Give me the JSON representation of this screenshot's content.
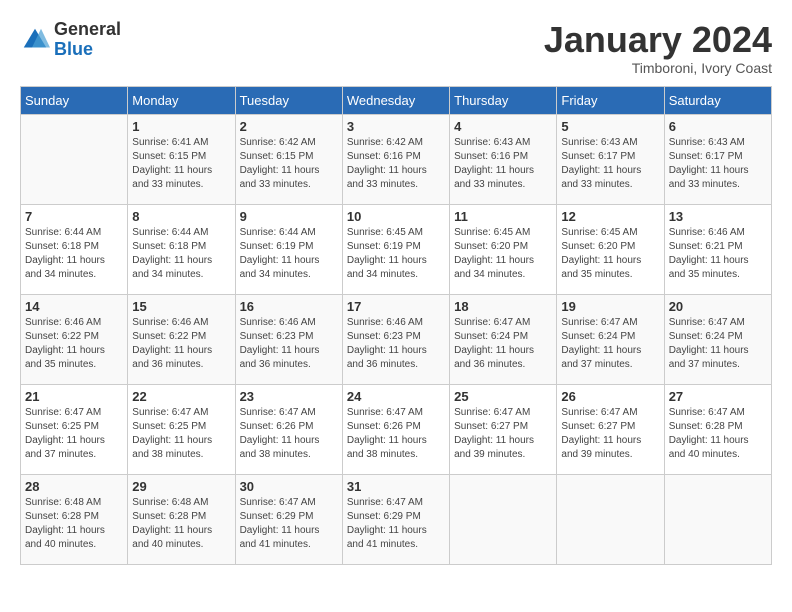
{
  "header": {
    "logo_general": "General",
    "logo_blue": "Blue",
    "month_title": "January 2024",
    "subtitle": "Timboroni, Ivory Coast"
  },
  "days_of_week": [
    "Sunday",
    "Monday",
    "Tuesday",
    "Wednesday",
    "Thursday",
    "Friday",
    "Saturday"
  ],
  "weeks": [
    [
      {
        "day": "",
        "sunrise": "",
        "sunset": "",
        "daylight": ""
      },
      {
        "day": "1",
        "sunrise": "Sunrise: 6:41 AM",
        "sunset": "Sunset: 6:15 PM",
        "daylight": "Daylight: 11 hours and 33 minutes."
      },
      {
        "day": "2",
        "sunrise": "Sunrise: 6:42 AM",
        "sunset": "Sunset: 6:15 PM",
        "daylight": "Daylight: 11 hours and 33 minutes."
      },
      {
        "day": "3",
        "sunrise": "Sunrise: 6:42 AM",
        "sunset": "Sunset: 6:16 PM",
        "daylight": "Daylight: 11 hours and 33 minutes."
      },
      {
        "day": "4",
        "sunrise": "Sunrise: 6:43 AM",
        "sunset": "Sunset: 6:16 PM",
        "daylight": "Daylight: 11 hours and 33 minutes."
      },
      {
        "day": "5",
        "sunrise": "Sunrise: 6:43 AM",
        "sunset": "Sunset: 6:17 PM",
        "daylight": "Daylight: 11 hours and 33 minutes."
      },
      {
        "day": "6",
        "sunrise": "Sunrise: 6:43 AM",
        "sunset": "Sunset: 6:17 PM",
        "daylight": "Daylight: 11 hours and 33 minutes."
      }
    ],
    [
      {
        "day": "7",
        "sunrise": "Sunrise: 6:44 AM",
        "sunset": "Sunset: 6:18 PM",
        "daylight": "Daylight: 11 hours and 34 minutes."
      },
      {
        "day": "8",
        "sunrise": "Sunrise: 6:44 AM",
        "sunset": "Sunset: 6:18 PM",
        "daylight": "Daylight: 11 hours and 34 minutes."
      },
      {
        "day": "9",
        "sunrise": "Sunrise: 6:44 AM",
        "sunset": "Sunset: 6:19 PM",
        "daylight": "Daylight: 11 hours and 34 minutes."
      },
      {
        "day": "10",
        "sunrise": "Sunrise: 6:45 AM",
        "sunset": "Sunset: 6:19 PM",
        "daylight": "Daylight: 11 hours and 34 minutes."
      },
      {
        "day": "11",
        "sunrise": "Sunrise: 6:45 AM",
        "sunset": "Sunset: 6:20 PM",
        "daylight": "Daylight: 11 hours and 34 minutes."
      },
      {
        "day": "12",
        "sunrise": "Sunrise: 6:45 AM",
        "sunset": "Sunset: 6:20 PM",
        "daylight": "Daylight: 11 hours and 35 minutes."
      },
      {
        "day": "13",
        "sunrise": "Sunrise: 6:46 AM",
        "sunset": "Sunset: 6:21 PM",
        "daylight": "Daylight: 11 hours and 35 minutes."
      }
    ],
    [
      {
        "day": "14",
        "sunrise": "Sunrise: 6:46 AM",
        "sunset": "Sunset: 6:22 PM",
        "daylight": "Daylight: 11 hours and 35 minutes."
      },
      {
        "day": "15",
        "sunrise": "Sunrise: 6:46 AM",
        "sunset": "Sunset: 6:22 PM",
        "daylight": "Daylight: 11 hours and 36 minutes."
      },
      {
        "day": "16",
        "sunrise": "Sunrise: 6:46 AM",
        "sunset": "Sunset: 6:23 PM",
        "daylight": "Daylight: 11 hours and 36 minutes."
      },
      {
        "day": "17",
        "sunrise": "Sunrise: 6:46 AM",
        "sunset": "Sunset: 6:23 PM",
        "daylight": "Daylight: 11 hours and 36 minutes."
      },
      {
        "day": "18",
        "sunrise": "Sunrise: 6:47 AM",
        "sunset": "Sunset: 6:24 PM",
        "daylight": "Daylight: 11 hours and 36 minutes."
      },
      {
        "day": "19",
        "sunrise": "Sunrise: 6:47 AM",
        "sunset": "Sunset: 6:24 PM",
        "daylight": "Daylight: 11 hours and 37 minutes."
      },
      {
        "day": "20",
        "sunrise": "Sunrise: 6:47 AM",
        "sunset": "Sunset: 6:24 PM",
        "daylight": "Daylight: 11 hours and 37 minutes."
      }
    ],
    [
      {
        "day": "21",
        "sunrise": "Sunrise: 6:47 AM",
        "sunset": "Sunset: 6:25 PM",
        "daylight": "Daylight: 11 hours and 37 minutes."
      },
      {
        "day": "22",
        "sunrise": "Sunrise: 6:47 AM",
        "sunset": "Sunset: 6:25 PM",
        "daylight": "Daylight: 11 hours and 38 minutes."
      },
      {
        "day": "23",
        "sunrise": "Sunrise: 6:47 AM",
        "sunset": "Sunset: 6:26 PM",
        "daylight": "Daylight: 11 hours and 38 minutes."
      },
      {
        "day": "24",
        "sunrise": "Sunrise: 6:47 AM",
        "sunset": "Sunset: 6:26 PM",
        "daylight": "Daylight: 11 hours and 38 minutes."
      },
      {
        "day": "25",
        "sunrise": "Sunrise: 6:47 AM",
        "sunset": "Sunset: 6:27 PM",
        "daylight": "Daylight: 11 hours and 39 minutes."
      },
      {
        "day": "26",
        "sunrise": "Sunrise: 6:47 AM",
        "sunset": "Sunset: 6:27 PM",
        "daylight": "Daylight: 11 hours and 39 minutes."
      },
      {
        "day": "27",
        "sunrise": "Sunrise: 6:47 AM",
        "sunset": "Sunset: 6:28 PM",
        "daylight": "Daylight: 11 hours and 40 minutes."
      }
    ],
    [
      {
        "day": "28",
        "sunrise": "Sunrise: 6:48 AM",
        "sunset": "Sunset: 6:28 PM",
        "daylight": "Daylight: 11 hours and 40 minutes."
      },
      {
        "day": "29",
        "sunrise": "Sunrise: 6:48 AM",
        "sunset": "Sunset: 6:28 PM",
        "daylight": "Daylight: 11 hours and 40 minutes."
      },
      {
        "day": "30",
        "sunrise": "Sunrise: 6:47 AM",
        "sunset": "Sunset: 6:29 PM",
        "daylight": "Daylight: 11 hours and 41 minutes."
      },
      {
        "day": "31",
        "sunrise": "Sunrise: 6:47 AM",
        "sunset": "Sunset: 6:29 PM",
        "daylight": "Daylight: 11 hours and 41 minutes."
      },
      {
        "day": "",
        "sunrise": "",
        "sunset": "",
        "daylight": ""
      },
      {
        "day": "",
        "sunrise": "",
        "sunset": "",
        "daylight": ""
      },
      {
        "day": "",
        "sunrise": "",
        "sunset": "",
        "daylight": ""
      }
    ]
  ]
}
